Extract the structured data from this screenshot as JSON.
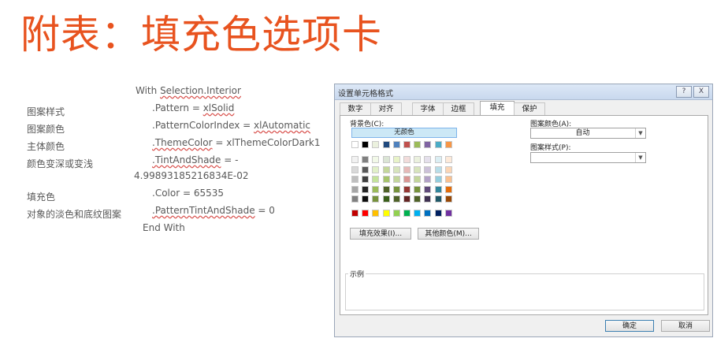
{
  "slide": {
    "title": "附表：填充色选项卡"
  },
  "labels": [
    "图案样式",
    "图案颜色",
    "主体颜色",
    "颜色变深或变浅",
    "填充色",
    "对象的淡色和底纹图案"
  ],
  "code": {
    "with": [
      "With ",
      "Selection.Interior"
    ],
    "pattern": [
      ".Pattern",
      " = ",
      "xlSolid"
    ],
    "pattern_color_index": [
      ".PatternColorIndex",
      " = ",
      "xlAutomatic"
    ],
    "theme_color": [
      ".ThemeColor",
      " = xlThemeColorDark1"
    ],
    "tint_and_shade": [
      ".TintAndShade",
      " = -"
    ],
    "tint_value": "4.99893185216834E-02",
    "color": ".Color = 65535",
    "pattern_tint": [
      ".PatternTintAndShade",
      " = 0"
    ],
    "end_with": "End With"
  },
  "dialog": {
    "title": "设置单元格格式",
    "help_button": "?",
    "close_button": "X",
    "tabs": [
      "数字",
      "对齐",
      "字体",
      "边框",
      "填充",
      "保护"
    ],
    "active_tab": "填充",
    "background_color_label": "背景色(C):",
    "no_color_label": "无颜色",
    "fill_effects_button": "填充效果(I)...",
    "more_colors_button": "其他颜色(M)...",
    "pattern_color_label": "图案颜色(A):",
    "pattern_color_value": "自动",
    "pattern_style_label": "图案样式(P):",
    "pattern_style_value": "",
    "sample_label": "示例",
    "ok_button": "确定",
    "cancel_button": "取消",
    "palette": {
      "theme_row": [
        "#ffffff",
        "#000000",
        "#ebf1de",
        "#1f497d",
        "#4f81bd",
        "#c0504d",
        "#9bbb59",
        "#8064a2",
        "#4bacc6",
        "#f79646"
      ],
      "shade_rows": [
        [
          "#f2f2f2",
          "#808080",
          "#f2f9e8",
          "#dbe5d5",
          "#e8f3c8",
          "#f2dcdb",
          "#ebf1de",
          "#e5e0ec",
          "#dbeef3",
          "#fdeada"
        ],
        [
          "#d9d9d9",
          "#595959",
          "#e1f0c8",
          "#c4d79b",
          "#d7e4bc",
          "#e6b9b8",
          "#d7e4bc",
          "#ccc1d9",
          "#b7dde8",
          "#fbd5b5"
        ],
        [
          "#bfbfbf",
          "#404040",
          "#c4e39a",
          "#a6c46b",
          "#c3d69b",
          "#d99694",
          "#c3d69b",
          "#b2a1c7",
          "#93cddd",
          "#fac08f"
        ],
        [
          "#a6a6a6",
          "#262626",
          "#9bbb59",
          "#4f6228",
          "#76923c",
          "#953734",
          "#76923c",
          "#5f497a",
          "#31859b",
          "#e36c09"
        ],
        [
          "#808080",
          "#0d0d0d",
          "#76923c",
          "#3a5f1a",
          "#4f6228",
          "#632423",
          "#4f6228",
          "#3f3151",
          "#205867",
          "#974806"
        ]
      ],
      "standard_row": [
        "#c00000",
        "#ff0000",
        "#ffc000",
        "#ffff00",
        "#92d050",
        "#00b050",
        "#00b0f0",
        "#0070c0",
        "#002060",
        "#7030a0"
      ]
    }
  }
}
